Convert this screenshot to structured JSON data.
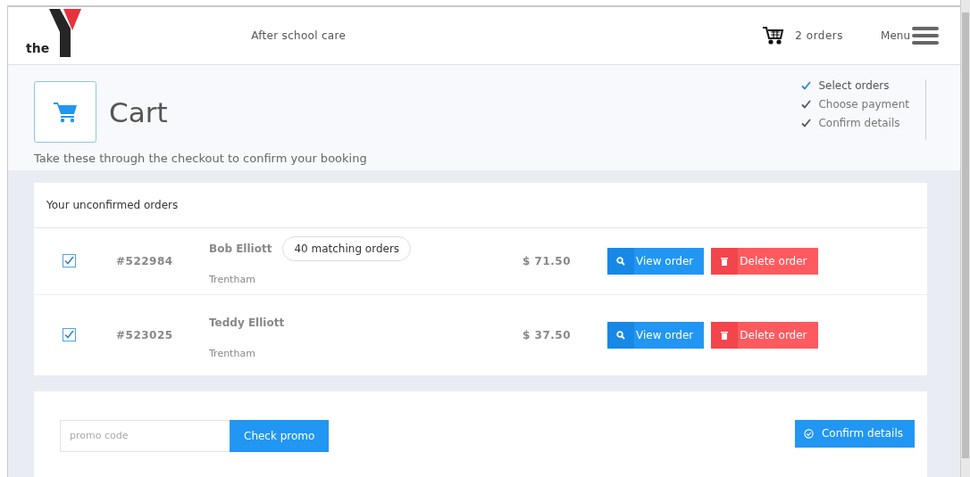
{
  "header": {
    "logo_text": "the",
    "service": "After school care",
    "cart_count": "2 orders",
    "menu_label": "Menu"
  },
  "hero": {
    "title": "Cart",
    "subtitle": "Take these through the checkout to confirm your booking",
    "steps": [
      {
        "label": "Select orders",
        "selected": true
      },
      {
        "label": "Choose payment",
        "selected": false
      },
      {
        "label": "Confirm details",
        "selected": false
      }
    ]
  },
  "orders": {
    "title": "Your unconfirmed orders",
    "rows": [
      {
        "checked": true,
        "id": "#522984",
        "name": "Bob Elliott",
        "badge": "40 matching orders",
        "location": "Trentham",
        "price": "$ 71.50",
        "view": "View order",
        "delete": "Delete order"
      },
      {
        "checked": true,
        "id": "#523025",
        "name": "Teddy Elliott",
        "location": "Trentham",
        "price": "$ 37.50",
        "view": "View order",
        "delete": "Delete order"
      }
    ]
  },
  "promo": {
    "placeholder": "promo code",
    "check": "Check promo",
    "confirm": "Confirm details"
  }
}
